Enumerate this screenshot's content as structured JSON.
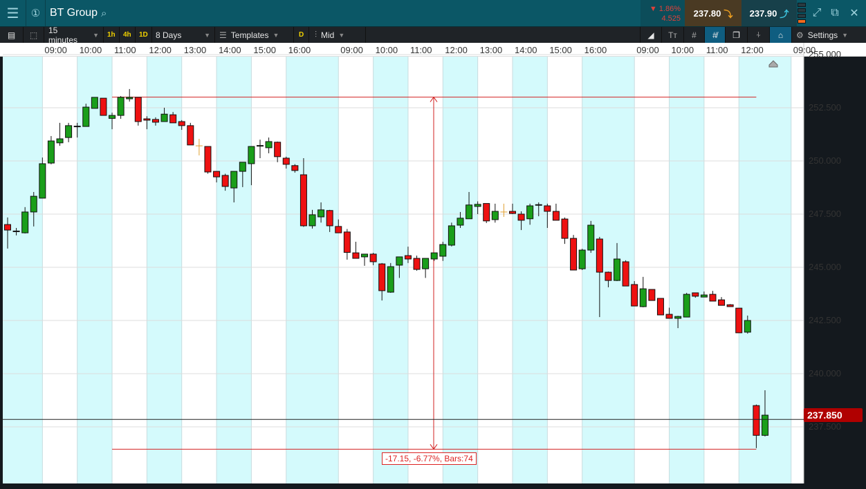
{
  "header": {
    "title": "BT Group",
    "change_pct": "1.86%",
    "change_abs": "4.525",
    "sell_price": "237.80",
    "buy_price": "237.90"
  },
  "toolbar": {
    "interval": "15 minutes",
    "quick_1h": "1h",
    "quick_4h": "4h",
    "quick_1d": "1D",
    "range": "8 Days",
    "templates": "Templates",
    "d_label": "D",
    "price_type": "Mid",
    "settings": "Settings"
  },
  "time_labels": [
    {
      "text": "09:00",
      "i": 4
    },
    {
      "text": "10:00",
      "i": 8
    },
    {
      "text": "11:00",
      "i": 12
    },
    {
      "text": "12:00",
      "i": 16
    },
    {
      "text": "13:00",
      "i": 20
    },
    {
      "text": "14:00",
      "i": 24
    },
    {
      "text": "15:00",
      "i": 28
    },
    {
      "text": "16:00",
      "i": 32
    },
    {
      "text": "09:00",
      "i": 38
    },
    {
      "text": "10:00",
      "i": 42
    },
    {
      "text": "11:00",
      "i": 46
    },
    {
      "text": "12:00",
      "i": 50
    },
    {
      "text": "13:00",
      "i": 54
    },
    {
      "text": "14:00",
      "i": 58
    },
    {
      "text": "15:00",
      "i": 62
    },
    {
      "text": "16:00",
      "i": 66
    },
    {
      "text": "09:00",
      "i": 72
    },
    {
      "text": "10:00",
      "i": 76
    },
    {
      "text": "11:00",
      "i": 80
    },
    {
      "text": "12:00",
      "i": 84
    },
    {
      "text": "09:00",
      "i": 90
    }
  ],
  "price_labels": [
    "255.000",
    "252.500",
    "250.000",
    "247.500",
    "245.000",
    "242.500",
    "240.000",
    "237.500"
  ],
  "current_price": "237.850",
  "measure": {
    "label": "-17.15, -6.77%, Bars:74",
    "from_price": 253.0,
    "to_price": 236.45,
    "from_bar": 12,
    "to_bar": 86
  },
  "colors": {
    "up": "#1a9e1a",
    "down": "#ee1111",
    "highlight_doji": "#e0a030",
    "measure": "#d22222",
    "band": "#d4fafc"
  },
  "chart_data": {
    "type": "candlestick",
    "highlight_doji_indices": [
      22,
      57
    ],
    "candles_ohlc": [
      [
        247.01,
        247.34,
        245.88,
        246.75
      ],
      [
        246.69,
        246.85,
        246.5,
        246.69
      ],
      [
        246.62,
        247.83,
        246.59,
        247.6
      ],
      [
        247.6,
        248.54,
        246.92,
        248.34
      ],
      [
        248.25,
        250.16,
        248.25,
        249.87
      ],
      [
        249.9,
        251.17,
        249.84,
        250.94
      ],
      [
        250.85,
        251.79,
        250.71,
        251.04
      ],
      [
        251.1,
        251.79,
        250.88,
        251.66
      ],
      [
        251.62,
        251.79,
        251.1,
        251.62
      ],
      [
        251.62,
        252.69,
        251.62,
        252.53
      ],
      [
        252.47,
        252.99,
        252.47,
        252.99
      ],
      [
        252.95,
        252.95,
        252.14,
        252.14
      ],
      [
        252.0,
        252.27,
        251.49,
        252.14
      ],
      [
        252.14,
        253.05,
        251.98,
        252.99
      ],
      [
        252.92,
        253.38,
        252.79,
        252.99
      ],
      [
        252.99,
        252.99,
        251.66,
        251.85
      ],
      [
        251.98,
        252.1,
        251.49,
        251.92
      ],
      [
        251.95,
        252.05,
        251.66,
        251.82
      ],
      [
        251.85,
        252.5,
        251.85,
        252.2
      ],
      [
        252.17,
        252.3,
        251.79,
        251.79
      ],
      [
        251.85,
        251.92,
        251.46,
        251.66
      ],
      [
        251.66,
        251.79,
        250.75,
        250.75
      ],
      [
        250.71,
        251.04,
        250.26,
        250.71
      ],
      [
        250.68,
        250.68,
        249.4,
        249.48
      ],
      [
        249.51,
        249.51,
        248.99,
        249.25
      ],
      [
        249.32,
        249.4,
        248.6,
        248.8
      ],
      [
        248.73,
        249.51,
        248.05,
        249.51
      ],
      [
        249.51,
        249.94,
        248.77,
        249.94
      ],
      [
        249.87,
        250.68,
        248.86,
        250.68
      ],
      [
        250.71,
        251.0,
        250.13,
        250.71
      ],
      [
        250.62,
        251.1,
        250.36,
        250.91
      ],
      [
        250.88,
        250.91,
        249.94,
        250.2
      ],
      [
        250.13,
        250.2,
        249.64,
        249.84
      ],
      [
        249.78,
        249.85,
        249.45,
        249.55
      ],
      [
        249.35,
        250.13,
        246.9,
        246.95
      ],
      [
        246.95,
        247.7,
        246.82,
        247.47
      ],
      [
        247.37,
        248.05,
        247.1,
        247.7
      ],
      [
        247.67,
        247.7,
        246.66,
        246.95
      ],
      [
        246.92,
        247.25,
        246.62,
        246.62
      ],
      [
        246.66,
        246.8,
        245.36,
        245.7
      ],
      [
        245.68,
        246.2,
        245.42,
        245.42
      ],
      [
        245.49,
        245.62,
        245.07,
        245.62
      ],
      [
        245.62,
        245.68,
        245.1,
        245.26
      ],
      [
        245.16,
        245.2,
        243.44,
        243.9
      ],
      [
        243.83,
        245.2,
        243.8,
        245.03
      ],
      [
        245.1,
        245.49,
        244.5,
        245.49
      ],
      [
        245.55,
        245.97,
        245.2,
        245.39
      ],
      [
        245.42,
        245.55,
        244.84,
        244.9
      ],
      [
        244.93,
        245.42,
        244.5,
        245.42
      ],
      [
        245.39,
        245.68,
        245.3,
        245.68
      ],
      [
        245.52,
        246.2,
        245.3,
        246.07
      ],
      [
        246.04,
        247.1,
        245.98,
        246.95
      ],
      [
        246.98,
        247.6,
        246.85,
        247.31
      ],
      [
        247.28,
        248.54,
        247.28,
        247.93
      ],
      [
        247.86,
        248.1,
        247.5,
        247.96
      ],
      [
        248.0,
        248.0,
        247.08,
        247.18
      ],
      [
        247.24,
        247.99,
        247.1,
        247.63
      ],
      [
        247.6,
        247.99,
        247.37,
        247.6
      ],
      [
        247.63,
        247.99,
        247.5,
        247.53
      ],
      [
        247.5,
        247.63,
        246.75,
        247.21
      ],
      [
        247.28,
        247.99,
        247.0,
        247.89
      ],
      [
        247.93,
        248.05,
        247.4,
        247.93
      ],
      [
        247.89,
        247.99,
        246.85,
        247.63
      ],
      [
        247.63,
        247.99,
        247.21,
        247.21
      ],
      [
        247.27,
        247.34,
        246.1,
        246.36
      ],
      [
        246.36,
        246.52,
        244.87,
        244.87
      ],
      [
        244.93,
        245.87,
        244.87,
        245.81
      ],
      [
        245.81,
        247.18,
        245.68,
        246.98
      ],
      [
        246.33,
        246.43,
        242.66,
        244.77
      ],
      [
        244.77,
        244.8,
        244.06,
        244.38
      ],
      [
        244.38,
        246.14,
        244.35,
        245.39
      ],
      [
        245.26,
        245.33,
        244.12,
        244.12
      ],
      [
        244.19,
        244.35,
        243.18,
        243.18
      ],
      [
        243.15,
        244.55,
        243.12,
        243.99
      ],
      [
        243.96,
        243.96,
        243.44,
        243.44
      ],
      [
        243.54,
        243.54,
        242.76,
        242.76
      ],
      [
        242.79,
        243.1,
        242.6,
        242.6
      ],
      [
        242.6,
        242.72,
        242.14,
        242.69
      ],
      [
        242.66,
        243.8,
        242.66,
        243.73
      ],
      [
        243.8,
        243.8,
        243.57,
        243.64
      ],
      [
        243.6,
        243.86,
        243.6,
        243.7
      ],
      [
        243.73,
        243.89,
        243.41,
        243.41
      ],
      [
        243.47,
        243.6,
        243.21,
        243.21
      ],
      [
        243.24,
        243.27,
        243.15,
        243.15
      ],
      [
        243.08,
        243.08,
        241.92,
        241.92
      ],
      [
        241.95,
        242.73,
        241.88,
        242.5
      ],
      [
        238.5,
        238.55,
        236.5,
        237.1
      ],
      [
        237.1,
        239.22,
        237.05,
        238.05
      ]
    ],
    "y_ticks": [
      255.0,
      252.5,
      250.0,
      247.5,
      245.0,
      242.5,
      240.0,
      237.5
    ],
    "current_price": 237.85
  }
}
